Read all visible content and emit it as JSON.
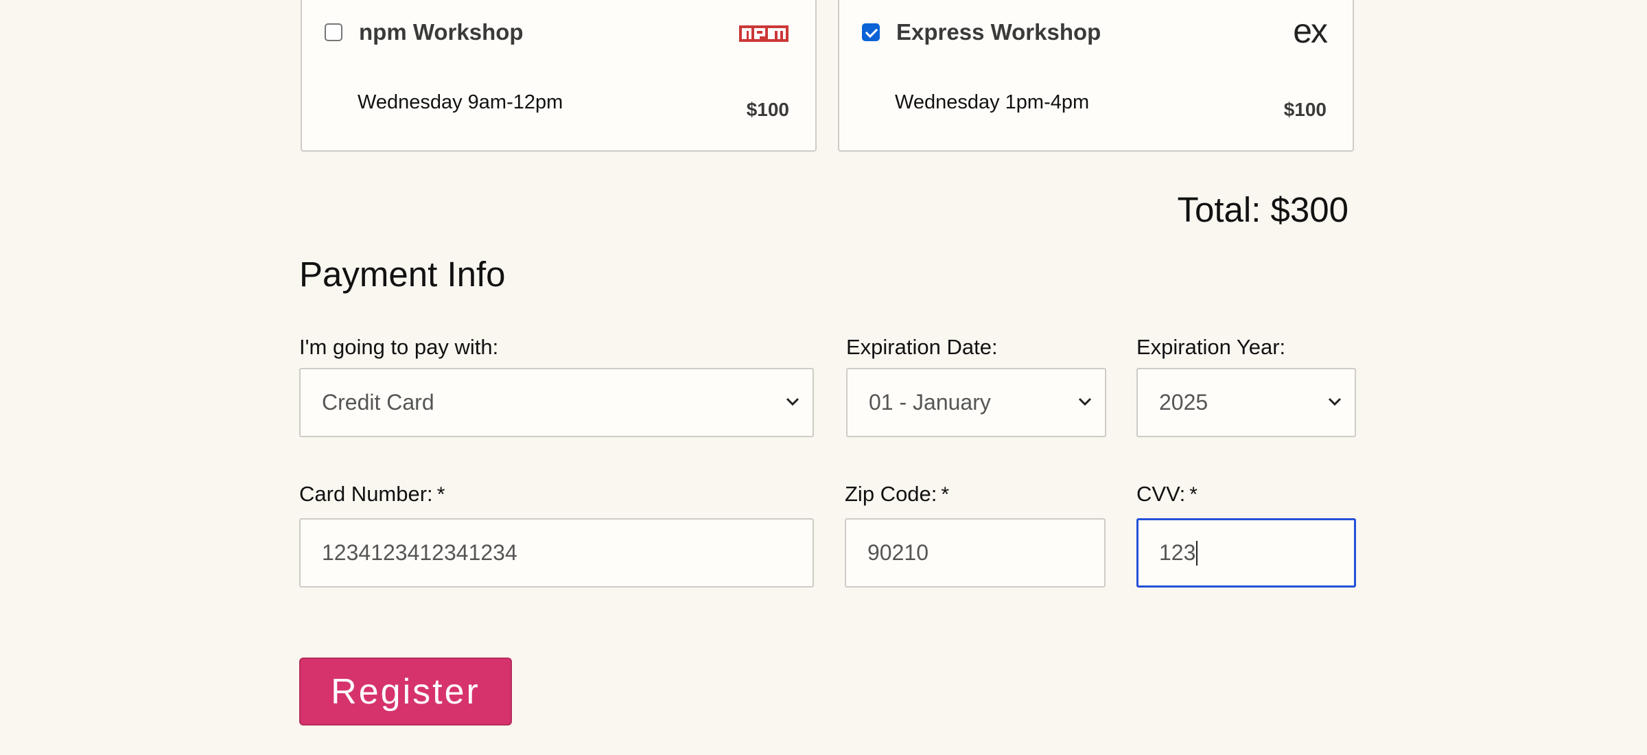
{
  "workshops": [
    {
      "title": "npm Workshop",
      "time": "Wednesday 9am-12pm",
      "price": "$100",
      "checked": false,
      "logo_icon": "npm-logo-icon",
      "logo_color": "#cb3837"
    },
    {
      "title": "Express Workshop",
      "time": "Wednesday 1pm-4pm",
      "price": "$100",
      "checked": true,
      "logo_icon": "express-logo-icon",
      "logo_text": "ex"
    }
  ],
  "total": "Total: $300",
  "payment": {
    "title": "Payment Info",
    "pay_with": {
      "label": "I'm going to pay with:",
      "value": "Credit Card"
    },
    "exp_date": {
      "label": "Expiration Date:",
      "value": "01 - January"
    },
    "exp_year": {
      "label": "Expiration Year:",
      "value": "2025"
    },
    "card_number": {
      "label": "Card Number:",
      "value": "1234123412341234"
    },
    "zip": {
      "label": "Zip Code:",
      "value": "90210"
    },
    "cvv": {
      "label": "CVV:",
      "value": "123"
    },
    "required_mark": "*"
  },
  "register_label": "Register",
  "colors": {
    "accent": "#d6336c",
    "focus": "#2350d8",
    "checkbox": "#0b63d6"
  }
}
